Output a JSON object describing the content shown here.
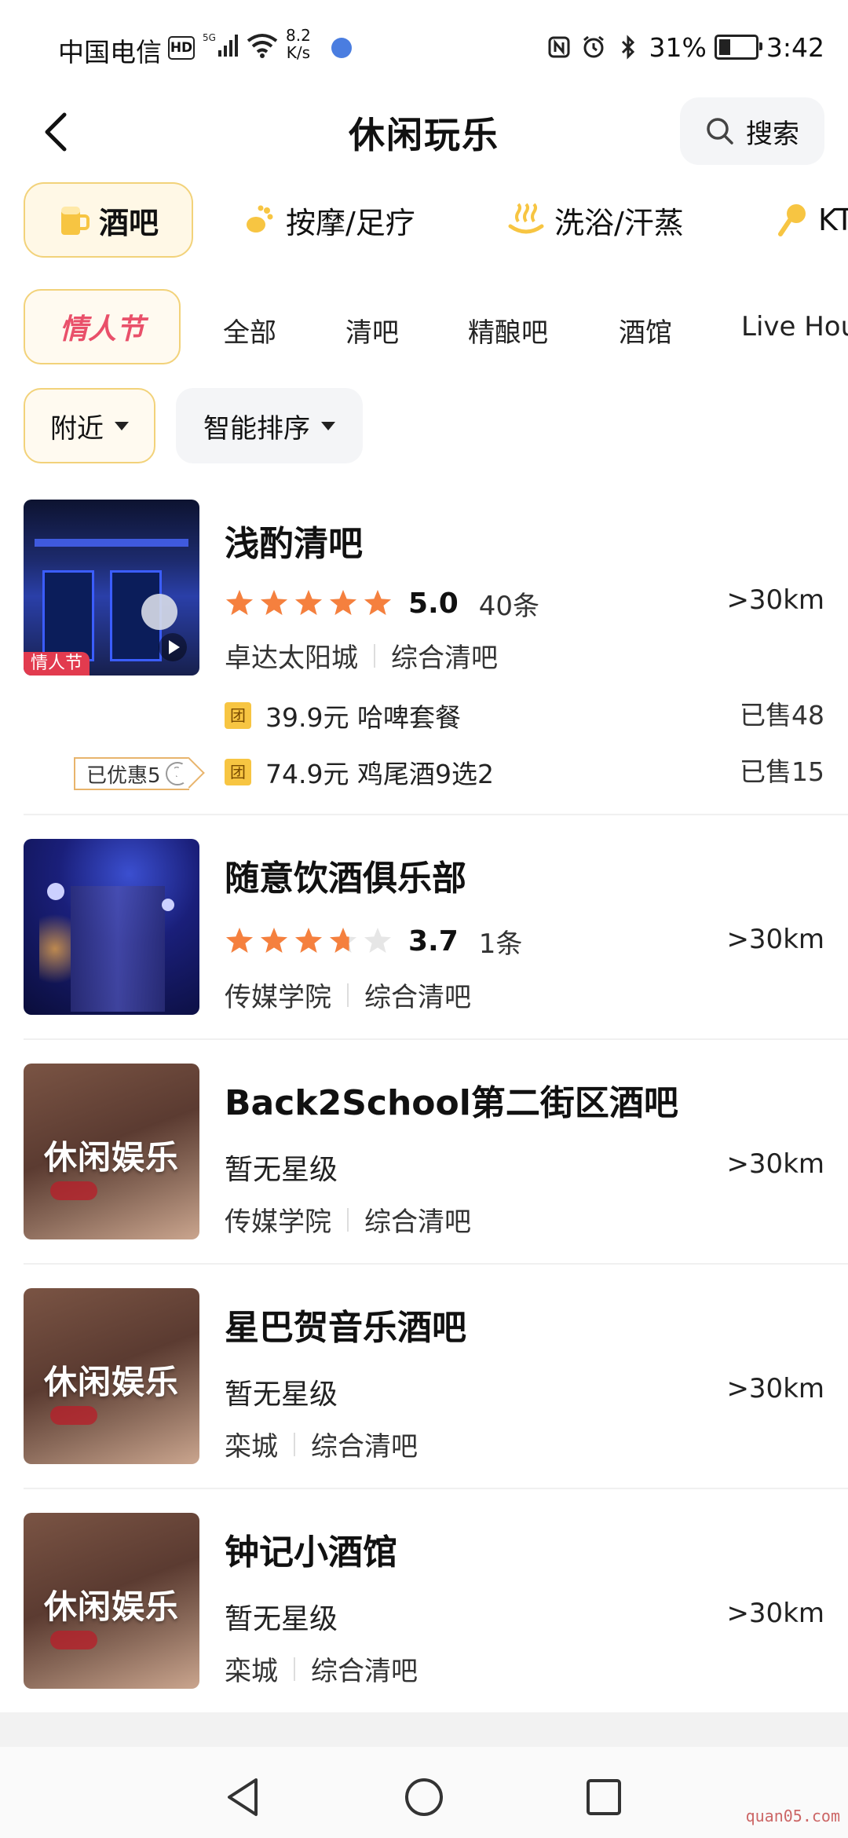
{
  "status": {
    "carrier": "中国电信",
    "hd": "HD",
    "speed_value": "8.2",
    "speed_unit": "K/s",
    "battery": "31%",
    "battery_level": 0.31,
    "time": "3:42"
  },
  "header": {
    "title": "休闲玩乐",
    "search_label": "搜索"
  },
  "categories": [
    {
      "label": "酒吧",
      "icon": "beer-icon",
      "active": true
    },
    {
      "label": "按摩/足疗",
      "icon": "foot-icon",
      "active": false
    },
    {
      "label": "洗浴/汗蒸",
      "icon": "hot-spring-icon",
      "active": false
    },
    {
      "label": "KT",
      "icon": "microphone-icon",
      "active": false
    }
  ],
  "subfilters": {
    "promo": "情人节",
    "items": [
      "全部",
      "清吧",
      "精酿吧",
      "酒馆",
      "Live Hou"
    ]
  },
  "sort": {
    "nearby": "附近",
    "smart": "智能排序"
  },
  "colors": {
    "accent_yellow": "#f7c542",
    "star_orange": "#f5803e",
    "promo_red": "#e9506a"
  },
  "listings": [
    {
      "name": "浅酌清吧",
      "rating": 5.0,
      "score": "5.0",
      "reviews": "40条",
      "distance": ">30km",
      "area": "卓达太阳城",
      "type": "综合清吧",
      "thumb_label": "情人节",
      "discount_tag": "已优惠5",
      "deals": [
        {
          "badge": "团",
          "text": "39.9元 哈啤套餐",
          "sold": "已售48"
        },
        {
          "badge": "团",
          "text": "74.9元 鸡尾酒9选2",
          "sold": "已售15"
        }
      ]
    },
    {
      "name": "随意饮酒俱乐部",
      "rating": 3.7,
      "score": "3.7",
      "reviews": "1条",
      "distance": ">30km",
      "area": "传媒学院",
      "type": "综合清吧"
    },
    {
      "name": "Back2School第二街区酒吧",
      "no_rating": "暂无星级",
      "distance": ">30km",
      "area": "传媒学院",
      "type": "综合清吧",
      "placeholder": "休闲娱乐"
    },
    {
      "name": "星巴贺音乐酒吧",
      "no_rating": "暂无星级",
      "distance": ">30km",
      "area": "栾城",
      "type": "综合清吧",
      "placeholder": "休闲娱乐"
    },
    {
      "name": "钟记小酒馆",
      "no_rating": "暂无星级",
      "distance": ">30km",
      "area": "栾城",
      "type": "综合清吧",
      "placeholder": "休闲娱乐"
    }
  ],
  "watermark": "quan05.com"
}
